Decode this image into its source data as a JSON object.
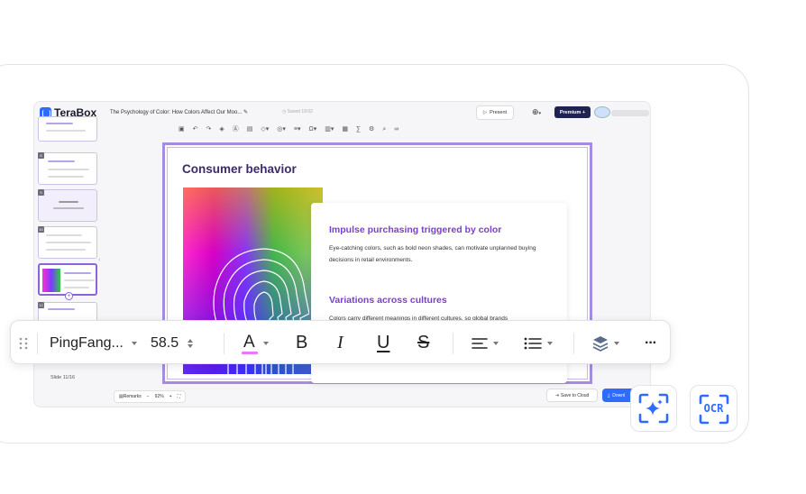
{
  "app": {
    "logo_text": "TeraBox",
    "doc_title": "The Psychology of Color: How Colors Affect Our Moo...",
    "saved_status": "Saved 19:02",
    "present_label": "Present",
    "premium_label": "Premium +",
    "slide_counter": "Slide 11/16",
    "remarks_label": "Remarks",
    "zoom_level": "92%",
    "save_cloud_label": "Save to Cloud",
    "download_label": "Downl"
  },
  "slide": {
    "title": "Consumer behavior",
    "heading_1": "Impulse purchasing triggered by color",
    "body_1": "Eye-catching colors, such as bold neon shades, can motivate unplanned buying decisions in retail environments.",
    "heading_2": "Variations across cultures",
    "body_2": "Colors carry different meanings in different cultures, so global brands"
  },
  "toolbar": {
    "font_name": "PingFang...",
    "font_size": "58.5",
    "bold_glyph": "B",
    "italic_glyph": "I",
    "underline_glyph": "U",
    "strike_glyph": "S",
    "more_glyph": "···",
    "text_color_accent": "#e879f9"
  },
  "side_tools": {
    "ocr_label": "OCR"
  },
  "colors": {
    "accent_purple": "#7b3fd0",
    "primary_blue": "#2f6bff",
    "premium_navy": "#1f2350"
  }
}
